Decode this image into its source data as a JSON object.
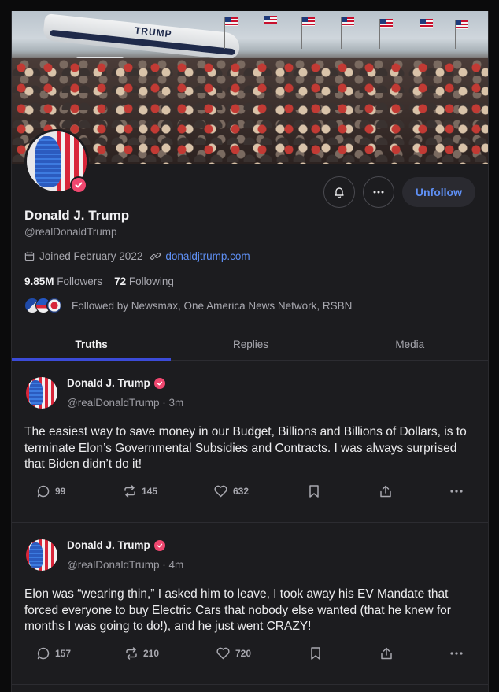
{
  "profile": {
    "name": "Donald J. Trump",
    "handle": "@realDonaldTrump",
    "joined": "Joined February 2022",
    "website": "donaldjtrump.com",
    "followers_count": "9.85M",
    "followers_label": "Followers",
    "following_count": "72",
    "following_label": "Following",
    "followed_by": "Followed by Newsmax, One America News Network, RSBN",
    "banner_plane_text": "TRUMP"
  },
  "actions": {
    "unfollow_label": "Unfollow"
  },
  "tabs": [
    {
      "label": "Truths",
      "active": true
    },
    {
      "label": "Replies",
      "active": false
    },
    {
      "label": "Media",
      "active": false
    }
  ],
  "posts": [
    {
      "name": "Donald J. Trump",
      "handle_time": "@realDonaldTrump · 3m",
      "text": "The easiest way to save money in our Budget, Billions and Billions of Dollars, is to terminate Elon’s Governmental Subsidies and Contracts. I was always surprised that Biden didn’t do it!",
      "replies": "99",
      "retruths": "145",
      "likes": "632"
    },
    {
      "name": "Donald J. Trump",
      "handle_time": "@realDonaldTrump · 4m",
      "text": "Elon was “wearing thin,” I asked him to leave, I took away his EV Mandate that forced everyone to buy Electric Cars that nobody else wanted (that he knew for months I was going to do!), and he just went CRAZY!",
      "replies": "157",
      "retruths": "210",
      "likes": "720"
    }
  ],
  "colors": {
    "accent_blue": "#5f90f5",
    "verified_pink": "#ef476f",
    "tab_indicator": "#3b4bd8",
    "panel_bg": "#1c1c1f"
  },
  "icons": [
    "calendar-icon",
    "link-icon",
    "bell-icon",
    "more-icon",
    "verified-icon",
    "reply-icon",
    "retruth-icon",
    "like-icon",
    "bookmark-icon",
    "share-icon"
  ]
}
